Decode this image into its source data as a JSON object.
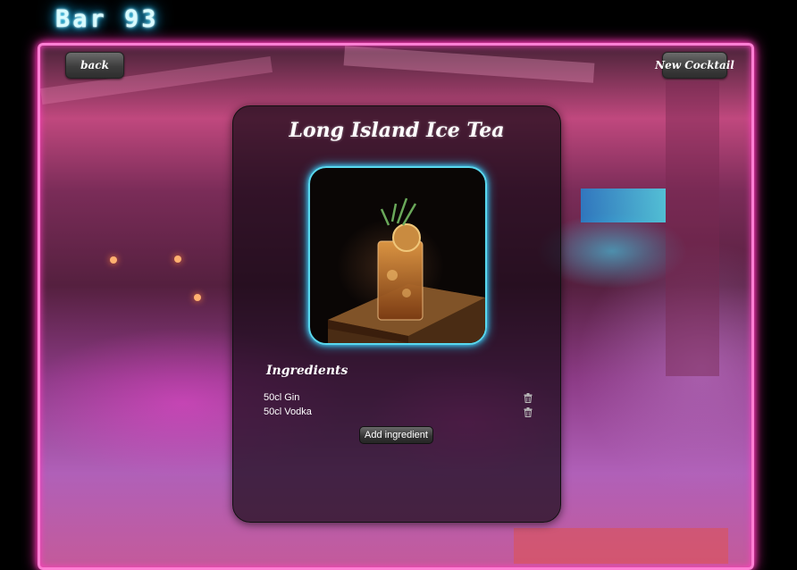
{
  "app": {
    "logo_text": "Bar 93"
  },
  "header": {
    "back_label": "back",
    "new_cocktail_label": "New Cocktail"
  },
  "cocktail": {
    "name": "Long Island Ice Tea",
    "image_alt": "Long Island Ice Tea"
  },
  "ingredients": {
    "title": "Ingredients",
    "items": [
      {
        "text": "50cl Gin"
      },
      {
        "text": "50cl Vodka"
      }
    ],
    "add_label": "Add ingredient"
  },
  "icons": {
    "delete": "trash-icon",
    "logo": "neon-logo"
  },
  "colors": {
    "neon_pink": "#ff3fc0",
    "neon_cyan": "#46d0ff",
    "card_background": "rgba(20,8,20,0.70)"
  }
}
